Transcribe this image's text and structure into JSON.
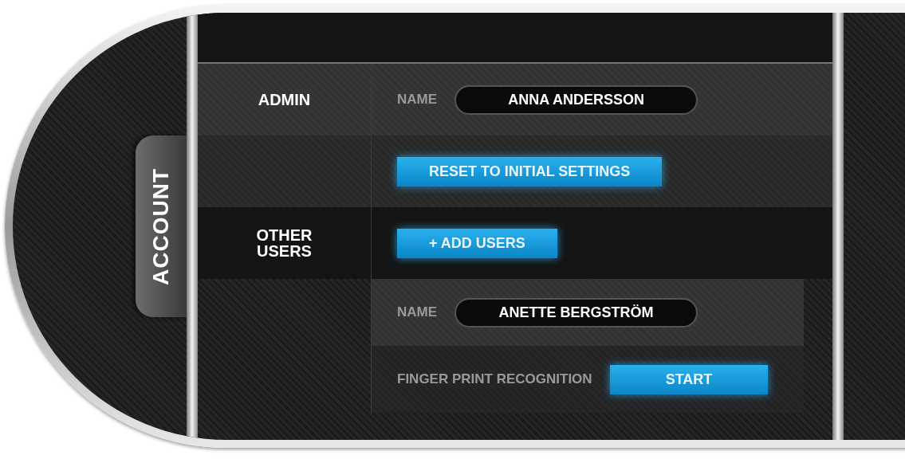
{
  "side_tab": {
    "label": "ACCOUNT",
    "selected": true
  },
  "admin": {
    "heading": "ADMIN",
    "name_label": "NAME",
    "name_value": "ANNA ANDERSSON",
    "reset_button": "RESET TO INITIAL SETTINGS"
  },
  "other_users": {
    "heading": "OTHER USERS",
    "add_button": "+ ADD USERS",
    "name_label": "NAME",
    "name_value": "ANETTE BERGSTRÖM",
    "fingerprint_label": "FINGER PRINT RECOGNITION",
    "start_button": "START"
  }
}
